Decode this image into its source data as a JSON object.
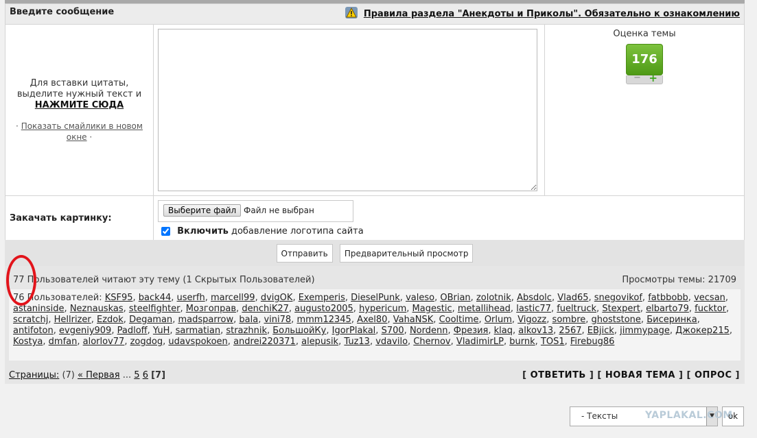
{
  "header": {
    "title": "Введите сообщение",
    "rules_link": "Правила раздела \"Анекдоты и Приколы\". Обязательно к ознакомлению"
  },
  "side": {
    "quote_hint_1": "Для вставки цитаты,",
    "quote_hint_2": "выделите нужный текст и",
    "quote_link": "НАЖМИТЕ СЮДА",
    "smiles_prefix": "·",
    "smiles_link": "Показать смайлики в новом окне",
    "smiles_suffix": "·"
  },
  "rating": {
    "title": "Оценка темы",
    "value": "176",
    "minus": "−",
    "plus": "+"
  },
  "upload": {
    "label": "Закачать картинку:",
    "file_button": "Выберите файл",
    "file_status": "Файл не выбран",
    "logo_bold": "Включить",
    "logo_rest": "добавление логотипа сайта",
    "logo_checked": true
  },
  "buttons": {
    "send": "Отправить",
    "preview": "Предварительный просмотр"
  },
  "readers": {
    "head": "77 Пользователей читают эту тему (1 Скрытых Пользователей)",
    "views": "Просмотры темы: 21709",
    "users_prefix": "76 Пользователей:",
    "users": [
      "KSF95",
      "back44",
      "userfh",
      "marcell99",
      "dvigOK",
      "Exemperis",
      "DieselPunk",
      "valeso",
      "OBrian",
      "zolotnik",
      "Absdolc",
      "Vlad65",
      "snegovikof",
      "fatbbobb",
      "vecsan",
      "astaninside",
      "Neznauskas",
      "steelfighter",
      "Мозгоправ",
      "denchiK27",
      "augusto2005",
      "hypericum",
      "Magestic",
      "metallihead",
      "lastic77",
      "fueltruck",
      "Stexpert",
      "elbarto79",
      "fucktor",
      "scratchj",
      "Hellrizer",
      "Ezdok",
      "Degaman",
      "madsparrow",
      "bala",
      "vini78",
      "mmm12345",
      "Axel80",
      "VahaNSK",
      "Cooltime",
      "Orlum",
      "Vigozz",
      "sombre",
      "ghoststone",
      "Бисеринка",
      "antifoton",
      "evgeniy909",
      "Padloff",
      "YuH",
      "sarmatian",
      "strazhnik",
      "БольшойКу",
      "IgorPlakal",
      "S700",
      "Nordenn",
      "Фрезия",
      "klaq",
      "alkov13",
      "2567",
      "EBjick",
      "jimmypage",
      "Джокер215",
      "Kostya",
      "dmfan",
      "alorlov77",
      "zogdog",
      "udavspokoen",
      "andrei220371",
      "alepusik",
      "Tuz13",
      "vdavilo",
      "Chernov",
      "VladimirLP",
      "burnk",
      "TOS1",
      "Firebug86"
    ]
  },
  "pages": {
    "label": "Страницы:",
    "count": "(7)",
    "first": "« Первая",
    "dots": "...",
    "p5": "5",
    "p6": "6",
    "current": "[7]"
  },
  "actions": {
    "reply": "ОТВЕТИТЬ",
    "new_topic": "НОВАЯ ТЕМА",
    "poll": "ОПРОС"
  },
  "jump": {
    "selected": "- Тексты",
    "ok": "ok"
  },
  "watermark": "YAPLAKAL.COM",
  "colors": {
    "rating_green": "#5ea624",
    "highlight_circle": "#e2141b"
  }
}
